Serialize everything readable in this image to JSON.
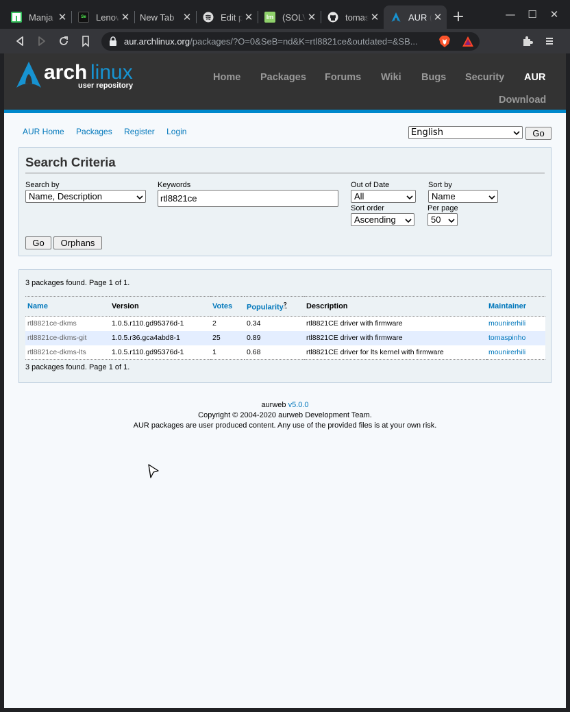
{
  "browser": {
    "tabs": [
      {
        "title": "Manja",
        "icon": "manjaro-icon",
        "active": false
      },
      {
        "title": "Lenov",
        "icon": "lenovo-forum-icon",
        "active": false
      },
      {
        "title": "New Tab",
        "icon": "",
        "active": false
      },
      {
        "title": "Edit p",
        "icon": "spotify-icon",
        "active": false
      },
      {
        "title": "(SOLV",
        "icon": "linux-mint-icon",
        "active": false
      },
      {
        "title": "tomas",
        "icon": "github-icon",
        "active": false
      },
      {
        "title": "AUR (",
        "icon": "arch-icon",
        "active": true
      }
    ],
    "new_tab_label": "+",
    "url_host": "aur.archlinux.org",
    "url_rest": "/packages/?O=0&SeB=nd&K=rtl8821ce&outdated=&SB..."
  },
  "site": {
    "logo_line1_a": "arch",
    "logo_line1_b": "linux",
    "logo_line2": "user repository",
    "nav": [
      "Home",
      "Packages",
      "Forums",
      "Wiki",
      "Bugs",
      "Security",
      "AUR"
    ],
    "nav_current": "AUR",
    "download": "Download"
  },
  "subnav": [
    "AUR Home",
    "Packages",
    "Register",
    "Login"
  ],
  "language": {
    "selected": "English",
    "go_label": "Go"
  },
  "search": {
    "title": "Search Criteria",
    "search_by_label": "Search by",
    "search_by_value": "Name, Description",
    "keywords_label": "Keywords",
    "keywords_value": "rtl8821ce",
    "out_of_date_label": "Out of Date",
    "out_of_date_value": "All",
    "sort_by_label": "Sort by",
    "sort_by_value": "Name",
    "sort_order_label": "Sort order",
    "sort_order_value": "Ascending",
    "per_page_label": "Per page",
    "per_page_value": "50",
    "go_label": "Go",
    "orphans_label": "Orphans"
  },
  "results": {
    "status": "3 packages found. Page 1 of 1.",
    "columns": [
      "Name",
      "Version",
      "Votes",
      "Popularity",
      "Description",
      "Maintainer"
    ],
    "popularity_help": "?",
    "rows": [
      {
        "name": "rtl8821ce-dkms",
        "version": "1.0.5.r110.gd95376d-1",
        "votes": "2",
        "popularity": "0.34",
        "description": "rtl8821CE driver with firmware",
        "maintainer": "mounirerhili"
      },
      {
        "name": "rtl8821ce-dkms-git",
        "version": "1.0.5.r36.gca4abd8-1",
        "votes": "25",
        "popularity": "0.89",
        "description": "rtl8821CE driver with firmware",
        "maintainer": "tomaspinho"
      },
      {
        "name": "rtl8821ce-dkms-lts",
        "version": "1.0.5.r110.gd95376d-1",
        "votes": "1",
        "popularity": "0.68",
        "description": "rtl8821CE driver for lts kernel with firmware",
        "maintainer": "mounirerhili"
      }
    ]
  },
  "footer": {
    "aurweb": "aurweb",
    "version": "v5.0.0",
    "copyright": "Copyright © 2004-2020 aurweb Development Team.",
    "notice": "AUR packages are user produced content. Any use of the provided files is at your own risk."
  },
  "colors": {
    "accent": "#0088cc",
    "header_bg": "#333333",
    "link": "#0077bb"
  }
}
